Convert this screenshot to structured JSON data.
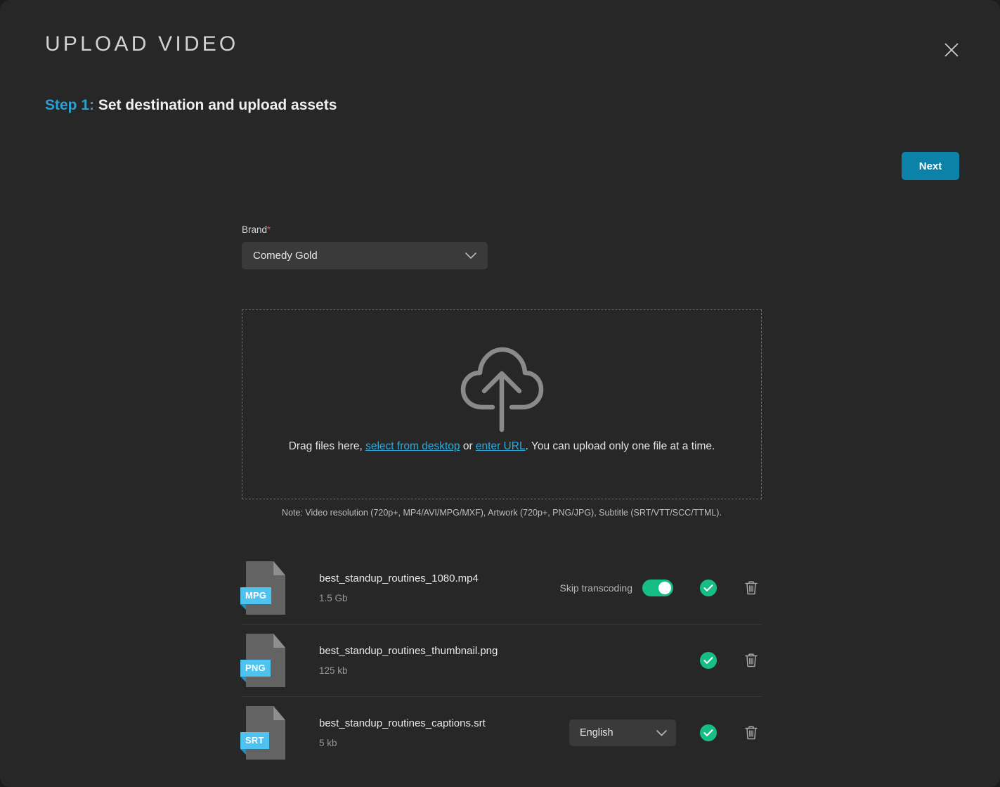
{
  "modal": {
    "title": "UPLOAD VIDEO",
    "close_icon": "close-icon",
    "step_label": "Step 1:",
    "step_text": "Set destination and upload assets",
    "next_label": "Next"
  },
  "brand": {
    "label": "Brand",
    "required_mark": "*",
    "value": "Comedy Gold",
    "chevron_icon": "chevron-down-icon"
  },
  "dropzone": {
    "cloud_icon": "cloud-upload-icon",
    "text_before": "Drag files here, ",
    "link_desktop": "select from desktop",
    "text_between": " or ",
    "link_url": "enter URL",
    "text_after": ". You can upload only one file at a time.",
    "note": "Note: Video resolution (720p+, MP4/AVI/MPG/MXF), Artwork (720p+, PNG/JPG), Subtitle (SRT/VTT/SCC/TTML)."
  },
  "files": [
    {
      "badge": "MPG",
      "name": "best_standup_routines_1080.mp4",
      "size": "1.5 Gb",
      "skip_label": "Skip transcoding",
      "skip_on": true,
      "has_toggle": true,
      "has_language": false,
      "language": "",
      "status_icon": "check-circle-icon",
      "delete_icon": "trash-icon"
    },
    {
      "badge": "PNG",
      "name": "best_standup_routines_thumbnail.png",
      "size": "125 kb",
      "skip_label": "",
      "skip_on": false,
      "has_toggle": false,
      "has_language": false,
      "language": "",
      "status_icon": "check-circle-icon",
      "delete_icon": "trash-icon"
    },
    {
      "badge": "SRT",
      "name": "best_standup_routines_captions.srt",
      "size": "5 kb",
      "skip_label": "",
      "skip_on": false,
      "has_toggle": false,
      "has_language": true,
      "language": "English",
      "status_icon": "check-circle-icon",
      "delete_icon": "trash-icon"
    }
  ],
  "colors": {
    "background": "#272727",
    "accent_blue": "#0d82a8",
    "link_blue": "#2eaadd",
    "step_blue": "#2d9fd1",
    "success_green": "#16bd85",
    "badge_cyan": "#4fc3f0",
    "required_red": "#e0474c"
  }
}
